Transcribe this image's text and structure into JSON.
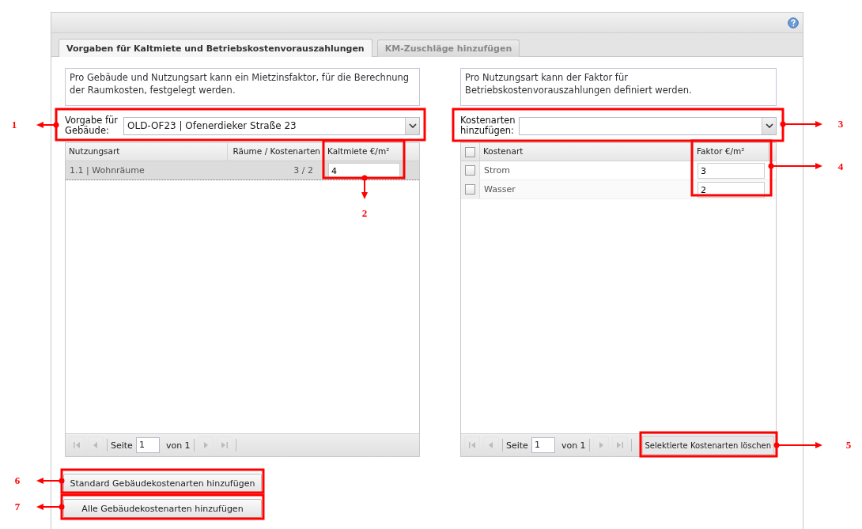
{
  "tabs": [
    {
      "label": "Vorgaben für Kaltmiete und Betriebskostenvorauszahlungen",
      "selected": true
    },
    {
      "label": "KM-Zuschläge hinzufügen",
      "selected": false
    }
  ],
  "left": {
    "description": "Pro Gebäude und Nutzungsart kann ein Mietzinsfaktor, für die Berechnung der Raumkosten, festgelegt werden.",
    "combo": {
      "label": "Vorgabe für Gebäude:",
      "value": "OLD-OF23 | Ofenerdieker Straße 23"
    },
    "columns": [
      "Nutzungsart",
      "Räume / Kostenarten",
      "Kaltmiete €/m²"
    ],
    "rows": [
      {
        "nutzungsart": "1.1 | Wohnräume",
        "count": "3 / 2",
        "value": "4",
        "selected": true
      }
    ],
    "paging": {
      "page_label": "Seite",
      "page": "1",
      "of": "von 1"
    }
  },
  "right": {
    "description": "Pro Nutzungsart kann der Faktor für Betriebskostenvorauszahlungen definiert werden.",
    "combo": {
      "label": "Kostenarten hinzufügen:"
    },
    "header_checked": false,
    "columns": [
      "Kostenart",
      "Faktor €/m²"
    ],
    "rows": [
      {
        "name": "Strom",
        "value": "3",
        "checked": false
      },
      {
        "name": "Wasser",
        "value": "2",
        "checked": false
      }
    ],
    "paging": {
      "page_label": "Seite",
      "page": "1",
      "of": "von 1"
    },
    "delete_button": "Selektierte Kostenarten löschen"
  },
  "buttons": [
    "Standard Gebäudekostenarten hinzufügen",
    "Alle Gebäudekostenarten hinzufügen"
  ],
  "callouts": [
    {
      "label": "1"
    },
    {
      "label": "2"
    },
    {
      "label": "3"
    },
    {
      "label": "4"
    },
    {
      "label": "5"
    },
    {
      "label": "6"
    },
    {
      "label": "7"
    }
  ]
}
